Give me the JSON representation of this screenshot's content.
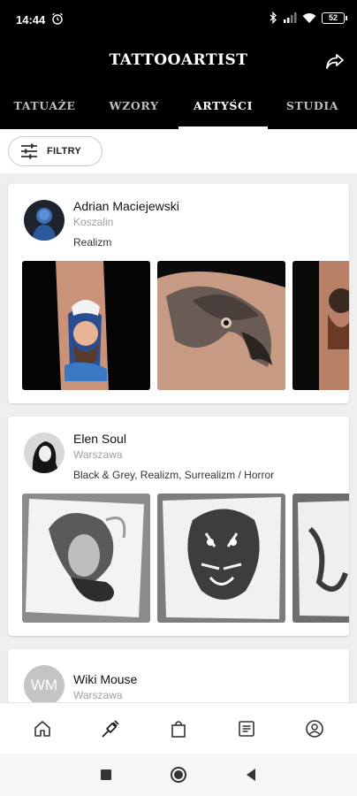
{
  "status_bar": {
    "time": "14:44",
    "battery": "52",
    "icons": [
      "alarm-icon",
      "bluetooth-icon",
      "signal-icon",
      "wifi-icon",
      "battery-icon"
    ]
  },
  "header": {
    "title": "TATTOOARTIST",
    "share_icon": "share-icon"
  },
  "tabs": [
    {
      "label": "TATUAŻE",
      "active": false
    },
    {
      "label": "WZORY",
      "active": false
    },
    {
      "label": "ARTYŚCI",
      "active": true
    },
    {
      "label": "STUDIA",
      "active": false
    }
  ],
  "filter": {
    "label": "FILTRY",
    "icon": "sliders-icon"
  },
  "artists": [
    {
      "name": "Adrian Maciejewski",
      "city": "Koszalin",
      "styles": "Realizm",
      "gallery": [
        "tattoo-sailor-portrait-image",
        "tattoo-eagle-image",
        "tattoo-portrait-image"
      ]
    },
    {
      "name": "Elen Soul",
      "city": "Warszawa",
      "styles": "Black & Grey, Realizm, Surrealizm / Horror",
      "gallery": [
        "drawing-woman-smoke-image",
        "drawing-tiger-image",
        "drawing-abstract-image"
      ]
    },
    {
      "name": "Wiki Mouse",
      "city": "Warszawa",
      "avatar_initials": "WM"
    }
  ],
  "bottom_nav": [
    "home-icon",
    "tattoo-machine-icon",
    "shop-bag-icon",
    "document-icon",
    "profile-icon"
  ],
  "system_nav": [
    "recent-apps-icon",
    "home-circle-icon",
    "back-icon"
  ],
  "colors": {
    "bar_bg": "#000000",
    "tab_active": "#ffffff",
    "tab_inactive": "#bdbdbd",
    "page_bg": "#efefef",
    "avatar_placeholder": "#c4c4c4"
  }
}
